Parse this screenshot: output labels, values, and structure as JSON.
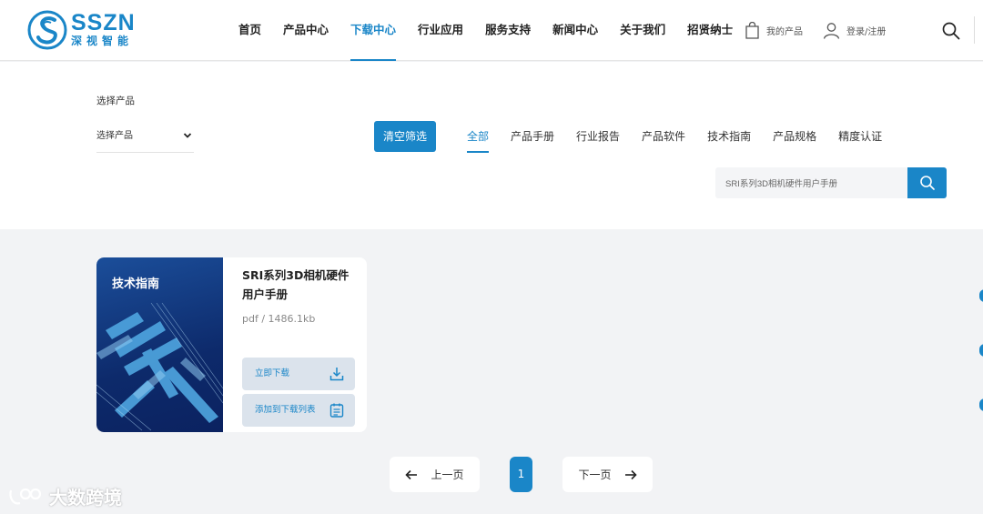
{
  "brand": {
    "name_en": "SSZN",
    "name_cn": "深视智能",
    "accent": "#1a86c8"
  },
  "nav": {
    "items": [
      {
        "label": "首页"
      },
      {
        "label": "产品中心"
      },
      {
        "label": "下载中心",
        "active": true
      },
      {
        "label": "行业应用"
      },
      {
        "label": "服务支持"
      },
      {
        "label": "新闻中心"
      },
      {
        "label": "关于我们"
      },
      {
        "label": "招贤纳士"
      }
    ],
    "my_products": "我的产品",
    "login": "登录/注册",
    "icons": [
      "bag-icon",
      "user-icon",
      "search-icon"
    ]
  },
  "filter": {
    "label": "选择产品",
    "select_value": "选择产品",
    "clear_label": "清空筛选",
    "tabs": [
      {
        "label": "全部",
        "active": true
      },
      {
        "label": "产品手册"
      },
      {
        "label": "行业报告"
      },
      {
        "label": "产品软件"
      },
      {
        "label": "技术指南"
      },
      {
        "label": "产品规格"
      },
      {
        "label": "精度认证"
      }
    ],
    "search_value": "SRI系列3D相机硬件用户手册"
  },
  "card": {
    "cover_label": "技术指南",
    "title": "SRI系列3D相机硬件用户手册",
    "meta": "pdf / 1486.1kb",
    "download_label": "立即下载",
    "add_label": "添加到下载列表"
  },
  "pagination": {
    "prev": "上一页",
    "current": "1",
    "next": "下一页"
  },
  "watermark": {
    "text": "大数跨境"
  }
}
